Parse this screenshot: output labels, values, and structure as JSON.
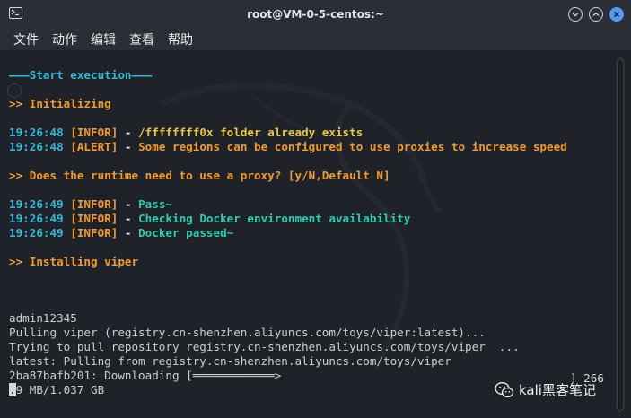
{
  "titlebar": {
    "title": "root@VM-0-5-centos:~",
    "icon": "terminal-icon"
  },
  "menubar": {
    "items": [
      "文件",
      "动作",
      "编辑",
      "查看",
      "帮助"
    ]
  },
  "terminal": {
    "start_line": "———Start execution———",
    "initializing": ">> Initializing",
    "l1_time": "19:26:48",
    "l1_tag": "[INFOR]",
    "l1_sep": " - ",
    "l1_msg": "/ffffffff0x folder already exists",
    "l2_time": "19:26:48",
    "l2_tag": "[ALERT]",
    "l2_sep": " - ",
    "l2_msg": "Some regions can be configured to use proxies to increase speed",
    "proxy_question": ">> Does the runtime need to use a proxy? [y/N,Default N]",
    "l3_time": "19:26:49",
    "l3_tag": "[INFOR]",
    "l3_sep": " - ",
    "l3_msg": "Pass~",
    "l4_time": "19:26:49",
    "l4_tag": "[INFOR]",
    "l4_sep": " - ",
    "l4_msg": "Checking Docker environment availability",
    "l5_time": "19:26:49",
    "l5_tag": "[INFOR]",
    "l5_sep": " - ",
    "l5_msg": "Docker passed~",
    "installing": ">> Installing viper",
    "out1": "admin12345",
    "out2": "Pulling viper (registry.cn-shenzhen.aliyuncs.com/toys/viper:latest)...",
    "out3": "Trying to pull repository registry.cn-shenzhen.aliyuncs.com/toys/viper  ...",
    "out4": "latest: Pulling from registry.cn-shenzhen.aliyuncs.com/toys/viper",
    "out5": "2ba87bafb201: Downloading [",
    "out5_bar": "════════════>",
    "out5_right": "] 266",
    "out6_cursor": ".",
    "out6": "9 MB/1.037 GB"
  },
  "watermark": {
    "text": "kali黑客笔记",
    "icon": "wechat-icon"
  }
}
